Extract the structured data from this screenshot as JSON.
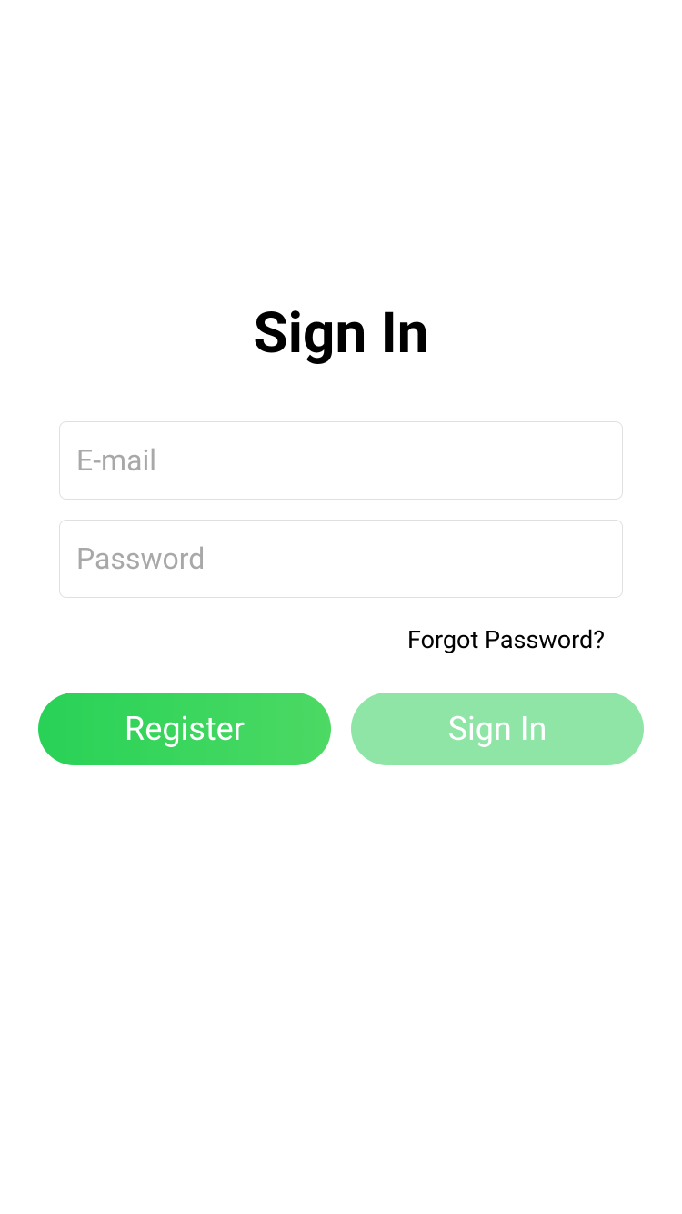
{
  "title": "Sign In",
  "inputs": {
    "email_placeholder": "E-mail",
    "password_placeholder": "Password"
  },
  "links": {
    "forgot_password": "Forgot Password?"
  },
  "buttons": {
    "register": "Register",
    "signin": "Sign In"
  }
}
